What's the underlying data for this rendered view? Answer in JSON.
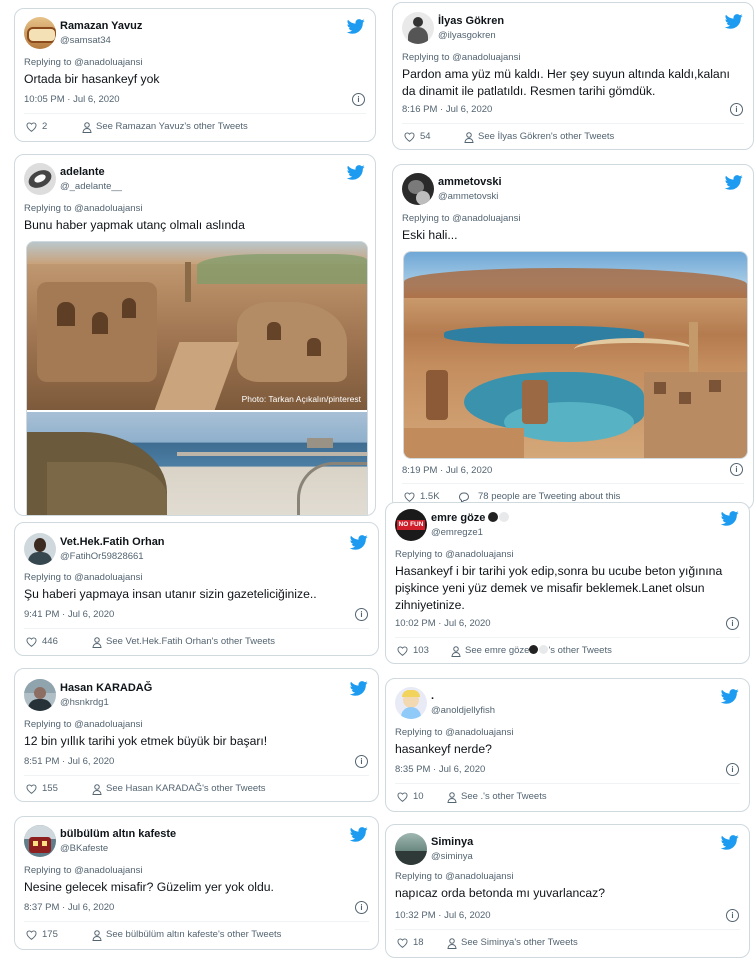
{
  "tweets": [
    {
      "name": "Ramazan Yavuz",
      "handle": "@samsat34",
      "replying": "Replying to @anadoluajansi",
      "text": "Ortada bir hasankeyf yok",
      "time": "10:05 PM · Jul 6, 2020",
      "likes": "2",
      "footer": "See Ramazan Yavuz's other Tweets"
    },
    {
      "name": "İlyas Gökren",
      "handle": "@ilyasgokren",
      "replying": "Replying to @anadoluajansi",
      "text": "Pardon ama yüz mü kaldı. Her şey suyun altında kaldı,kalanı da dinamit ile patlatıldı. Resmen tarihi gömdük.",
      "time": "8:16 PM · Jul 6, 2020",
      "likes": "54",
      "footer": "See İlyas Gökren's other Tweets"
    },
    {
      "name": "adelante",
      "handle": "@_adelante__",
      "replying": "Replying to @anadoluajansi",
      "text": "Bunu haber yapmak utanç olmalı aslında",
      "photo_credit": "Photo: Tarkan Açıkalın/pinterest"
    },
    {
      "name": "ammetovski",
      "handle": "@ammetovski",
      "replying": "Replying to @anadoluajansi",
      "text": "Eski hali...",
      "time": "8:19 PM · Jul 6, 2020",
      "likes": "1.5K",
      "footer": "78 people are Tweeting about this"
    },
    {
      "name": "Vet.Hek.Fatih Orhan",
      "handle": "@FatihOr59828661",
      "replying": "Replying to @anadoluajansi",
      "text": "Şu haberi yapmaya insan utanır sizin gazeteliciğinize..",
      "time": "9:41 PM · Jul 6, 2020",
      "likes": "446",
      "footer": "See Vet.Hek.Fatih Orhan's other Tweets"
    },
    {
      "name": "emre göze",
      "handle": "@emregze1",
      "replying": "Replying to @anadoluajansi",
      "text": "Hasankeyf i bir tarihi yok edip,sonra bu ucube beton yığınına pişkince yeni yüz demek ve misafir beklemek.Lanet olsun zihniyetinize.",
      "time": "10:02 PM · Jul 6, 2020",
      "likes": "103",
      "footer_pre": "See emre göze",
      "footer_post": "'s other Tweets",
      "avatar_text": "NO FUN"
    },
    {
      "name": "Hasan KARADAĞ",
      "handle": "@hsnkrdg1",
      "replying": "Replying to @anadoluajansi",
      "text": "12 bin yıllık tarihi yok etmek büyük bir başarı!",
      "time": "8:51 PM · Jul 6, 2020",
      "likes": "155",
      "footer": "See Hasan KARADAĞ's other Tweets"
    },
    {
      "name": ".",
      "handle": "@anoldjellyfish",
      "replying": "Replying to @anadoluajansi",
      "text": "hasankeyf nerde?",
      "time": "8:35 PM · Jul 6, 2020",
      "likes": "10",
      "footer": "See .'s other Tweets"
    },
    {
      "name": "bülbülüm altın kafeste",
      "handle": "@BKafeste",
      "replying": "Replying to @anadoluajansi",
      "text": "Nesine gelecek misafir? Güzelim yer yok oldu.",
      "time": "8:37 PM · Jul 6, 2020",
      "likes": "175",
      "footer": "See bülbülüm altın kafeste's other Tweets"
    },
    {
      "name": "Siminya",
      "handle": "@siminya",
      "replying": "Replying to @anadoluajansi",
      "text": "napıcaz orda betonda mı yuvarlancaz?",
      "time": "10:32 PM · Jul 6, 2020",
      "likes": "18",
      "footer": "See Siminya's other Tweets"
    }
  ],
  "colors": {
    "twitter_blue": "#1d9bf0",
    "muted": "#536471",
    "border": "#cfd9de"
  },
  "icons": {
    "bird": "twitter-bird-icon",
    "heart": "heart-icon",
    "person": "person-icon",
    "info": "info-icon",
    "bubble": "speech-bubble-icon"
  },
  "info_glyph": "i"
}
